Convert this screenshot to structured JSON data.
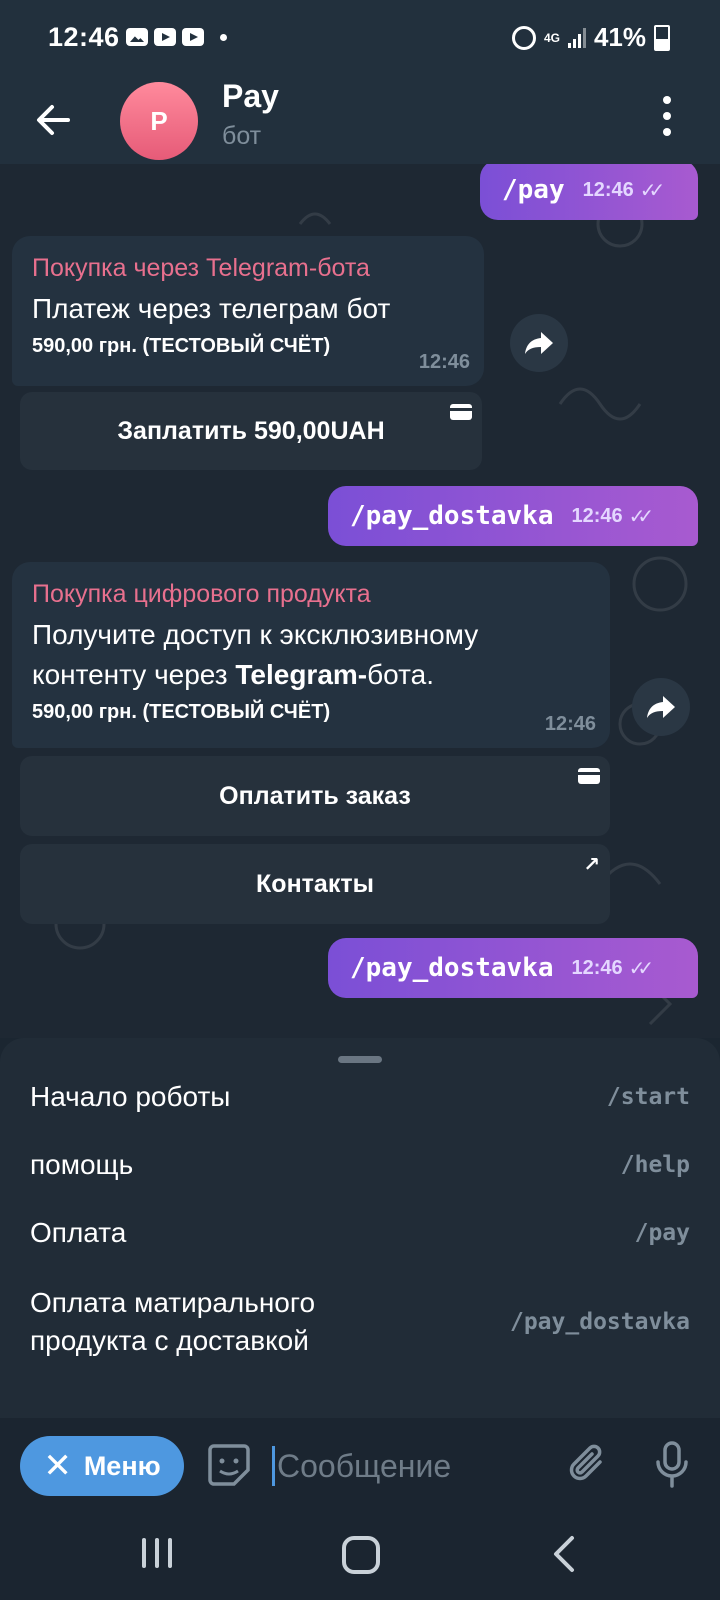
{
  "status_bar": {
    "time": "12:46",
    "network": "4G",
    "battery": "41%"
  },
  "header": {
    "avatar_letter": "P",
    "title": "Pay",
    "subtitle": "бот"
  },
  "messages": [
    {
      "kind": "outgoing",
      "text": "/pay",
      "time": "12:46"
    },
    {
      "kind": "invoice",
      "title": "Покупка через Telegram-бота",
      "body": "Платеж через телеграм бот",
      "price": "590,00 грн. (ТЕСТОВЫЙ СЧЁТ)",
      "time": "12:46",
      "buttons": [
        {
          "label": "Заплатить 590,00UAH",
          "icon": "card-icon"
        }
      ]
    },
    {
      "kind": "outgoing",
      "text": "/pay_dostavka",
      "time": "12:46"
    },
    {
      "kind": "invoice",
      "title": "Покупка цифрового продукта",
      "body_part1": "Получите доступ к эксклюзивному контенту через ",
      "body_bold": "Telegram-",
      "body_part2": "бота.",
      "price": "590,00 грн. (ТЕСТОВЫЙ СЧЁТ)",
      "time": "12:46",
      "buttons": [
        {
          "label": "Оплатить заказ",
          "icon": "card-icon"
        },
        {
          "label": "Контакты",
          "icon": "external-link-icon"
        }
      ]
    },
    {
      "kind": "outgoing",
      "text": "/pay_dostavka",
      "time": "12:46"
    }
  ],
  "commands": [
    {
      "label": "Начало роботы",
      "command": "/start"
    },
    {
      "label": "помощь",
      "command": "/help"
    },
    {
      "label": "Оплата",
      "command": "/pay"
    },
    {
      "label": "Оплата матирального продукта с доставкой",
      "command": "/pay_dostavka"
    }
  ],
  "input_bar": {
    "menu_label": "Меню",
    "placeholder": "Сообщение"
  },
  "colors": {
    "outgoing_bubble": "#8a52d4",
    "invoice_title": "#e8708e",
    "menu_button": "#4e98e0",
    "background": "#1e2833"
  }
}
